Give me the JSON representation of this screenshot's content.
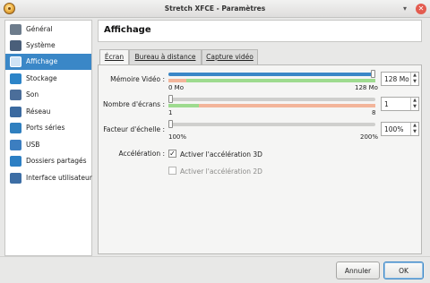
{
  "window": {
    "title": "Stretch XFCE - Paramètres"
  },
  "sidebar": {
    "items": [
      {
        "label": "Général",
        "icon": "general-icon",
        "color": "#6d7c8c",
        "active": false
      },
      {
        "label": "Système",
        "icon": "system-icon",
        "color": "#4a5f7a",
        "active": false
      },
      {
        "label": "Affichage",
        "icon": "display-icon",
        "color": "#2f6fb0",
        "active": true
      },
      {
        "label": "Stockage",
        "icon": "storage-icon",
        "color": "#2c84c8",
        "active": false
      },
      {
        "label": "Son",
        "icon": "sound-icon",
        "color": "#4b6e9a",
        "active": false
      },
      {
        "label": "Réseau",
        "icon": "network-icon",
        "color": "#3b6aa0",
        "active": false
      },
      {
        "label": "Ports séries",
        "icon": "serial-port-icon",
        "color": "#2f7fbf",
        "active": false
      },
      {
        "label": "USB",
        "icon": "usb-icon",
        "color": "#3c7ec0",
        "active": false
      },
      {
        "label": "Dossiers partagés",
        "icon": "shared-folders-icon",
        "color": "#2c7fc4",
        "active": false
      },
      {
        "label": "Interface utilisateur",
        "icon": "user-interface-icon",
        "color": "#3d6ea5",
        "active": false
      }
    ]
  },
  "panel": {
    "title": "Affichage",
    "tabs": [
      {
        "label": "Écran",
        "active": true
      },
      {
        "label": "Bureau à distance",
        "active": false
      },
      {
        "label": "Capture vidéo",
        "active": false
      }
    ]
  },
  "screen": {
    "video_memory": {
      "label": "Mémoire Vidéo :",
      "min_label": "0 Mo",
      "max_label": "128 Mo",
      "value": "128 Mo",
      "fraction": 1.0
    },
    "monitor_count": {
      "label": "Nombre d'écrans :",
      "min_label": "1",
      "max_label": "8",
      "value": "1",
      "fraction": 0.0
    },
    "scale_factor": {
      "label": "Facteur d'échelle :",
      "min_label": "100%",
      "max_label": "200%",
      "value": "100%",
      "fraction": 0.0
    },
    "acceleration": {
      "label": "Accélération :",
      "accel_3d": {
        "label": "Activer l'accélération 3D",
        "checked": true
      },
      "accel_2d": {
        "label": "Activer l'accélération 2D",
        "checked": false,
        "disabled": true
      }
    }
  },
  "footer": {
    "cancel_label": "Annuler",
    "ok_label": "OK"
  },
  "colors": {
    "accent": "#3a87c7",
    "range_ok": "#9edb8f",
    "range_warn": "#f3b59a"
  }
}
